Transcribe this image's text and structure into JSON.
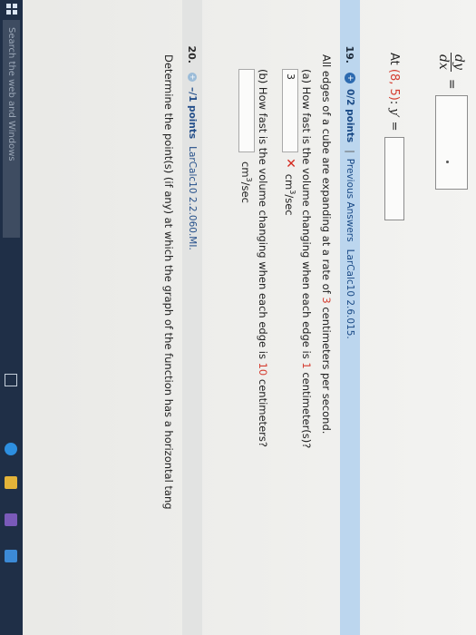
{
  "previous_question": {
    "deriv_numerator": "dy",
    "deriv_denominator": "dx",
    "equals": "=",
    "at_prefix": "At",
    "at_point": "(8, 5)",
    "at_suffix": ":",
    "y_prime": "y′ ="
  },
  "q19": {
    "number": "19.",
    "status_icon": "+",
    "points": "0/2 points",
    "separator": "|",
    "previous_answers": "Previous Answers",
    "source": "LarCalc10 2.6.015.",
    "statement_start": "All edges of a cube are expanding at a rate of ",
    "statement_rate": "3",
    "statement_end": " centimeters per second.",
    "part_a_prefix": "(a) How fast is the volume changing when each edge is ",
    "part_a_value": "1",
    "part_a_suffix": " centimeter(s)?",
    "part_a_answer": "3",
    "part_a_mark": "✕",
    "unit_base": "cm",
    "unit_exp": "3",
    "unit_tail": "/sec",
    "part_b_prefix": "(b) How fast is the volume changing when each edge is ",
    "part_b_value": "10",
    "part_b_suffix": " centimeters?",
    "part_b_answer": ""
  },
  "q20": {
    "number": "20.",
    "status_icon": "+",
    "points": "–/1 points",
    "source": "LarCalc10 2.2.060.MI.",
    "statement": "Determine the point(s) (if any) at which the graph of the function has a horizontal tang"
  },
  "taskbar": {
    "search_placeholder": "Search the web and Windows"
  },
  "colors": {
    "highlight": "#d43c2f",
    "header_blue": "#bcd6ee",
    "taskbar": "#1f2f47"
  }
}
